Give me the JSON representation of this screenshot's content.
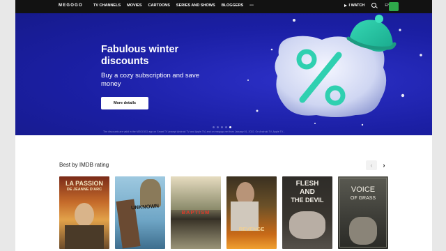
{
  "nav": {
    "logo": "MEGOGO",
    "items": [
      "TV CHANNELS",
      "MOVIES",
      "CARTOONS",
      "SERIES AND SHOWS",
      "BLOGGERS"
    ],
    "more": "•••",
    "iwatch": "I WATCH",
    "lang": "EN"
  },
  "banner": {
    "headline": "Fabulous winter discounts",
    "subline": "Buy a cozy subscription and save money",
    "cta": "More details",
    "disclaimer": "The discounts are valid in the MEGOGO app on Smart TV (except Android TV and Apple TV) and on megogo.net from January 01, 2022. On Android TV, Apple TV...",
    "dots_count": 5,
    "active_dot": 4
  },
  "section": {
    "title": "Best by IMDB rating",
    "prev": "‹",
    "next": "›"
  },
  "posters": [
    {
      "line1": "LA PASSION",
      "line2": "DE JEANNE D'ARC"
    },
    {
      "line1": "UNKNOWN",
      "line2": ""
    },
    {
      "line1": "BAPTISM",
      "line2": ""
    },
    {
      "line1": "REVENGE",
      "line2": ""
    },
    {
      "line1": "FLESH",
      "line2": "AND",
      "line3": "THE DEVIL"
    },
    {
      "line1": "VOICE",
      "line2": "OF GRASS"
    }
  ],
  "colors": {
    "nav_bg": "#121212",
    "banner_bg": "#1b1fa4",
    "accent_green": "#2ea84a",
    "teal": "#2fd0b0"
  }
}
